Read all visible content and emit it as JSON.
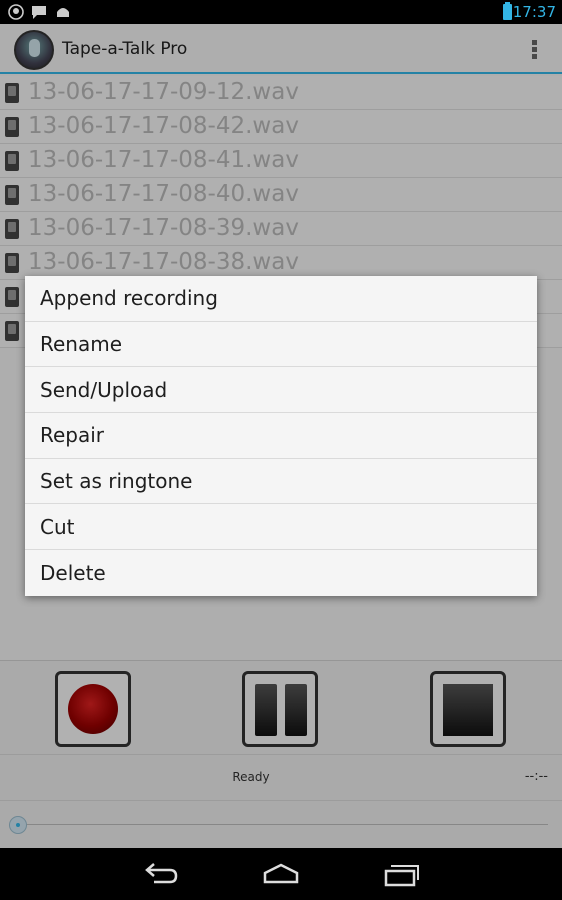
{
  "status_bar": {
    "time": "17:37",
    "icons": [
      "notification-icon",
      "chat-icon",
      "android-icon"
    ]
  },
  "action_bar": {
    "title": "Tape-a-Talk Pro"
  },
  "files": [
    {
      "name": "13-06-17-17-09-12.wav"
    },
    {
      "name": "13-06-17-17-08-42.wav"
    },
    {
      "name": "13-06-17-17-08-41.wav"
    },
    {
      "name": "13-06-17-17-08-40.wav"
    },
    {
      "name": "13-06-17-17-08-39.wav"
    },
    {
      "name": "13-06-17-17-08-38.wav"
    },
    {
      "name": ""
    },
    {
      "name": ""
    }
  ],
  "context_menu": {
    "items": [
      {
        "label": "Append recording"
      },
      {
        "label": "Rename"
      },
      {
        "label": "Send/Upload"
      },
      {
        "label": "Repair"
      },
      {
        "label": "Set as ringtone"
      },
      {
        "label": "Cut"
      },
      {
        "label": "Delete"
      }
    ]
  },
  "player": {
    "status": "Ready",
    "time": "--:--"
  },
  "colors": {
    "accent": "#33b5e5",
    "record": "#990000"
  }
}
